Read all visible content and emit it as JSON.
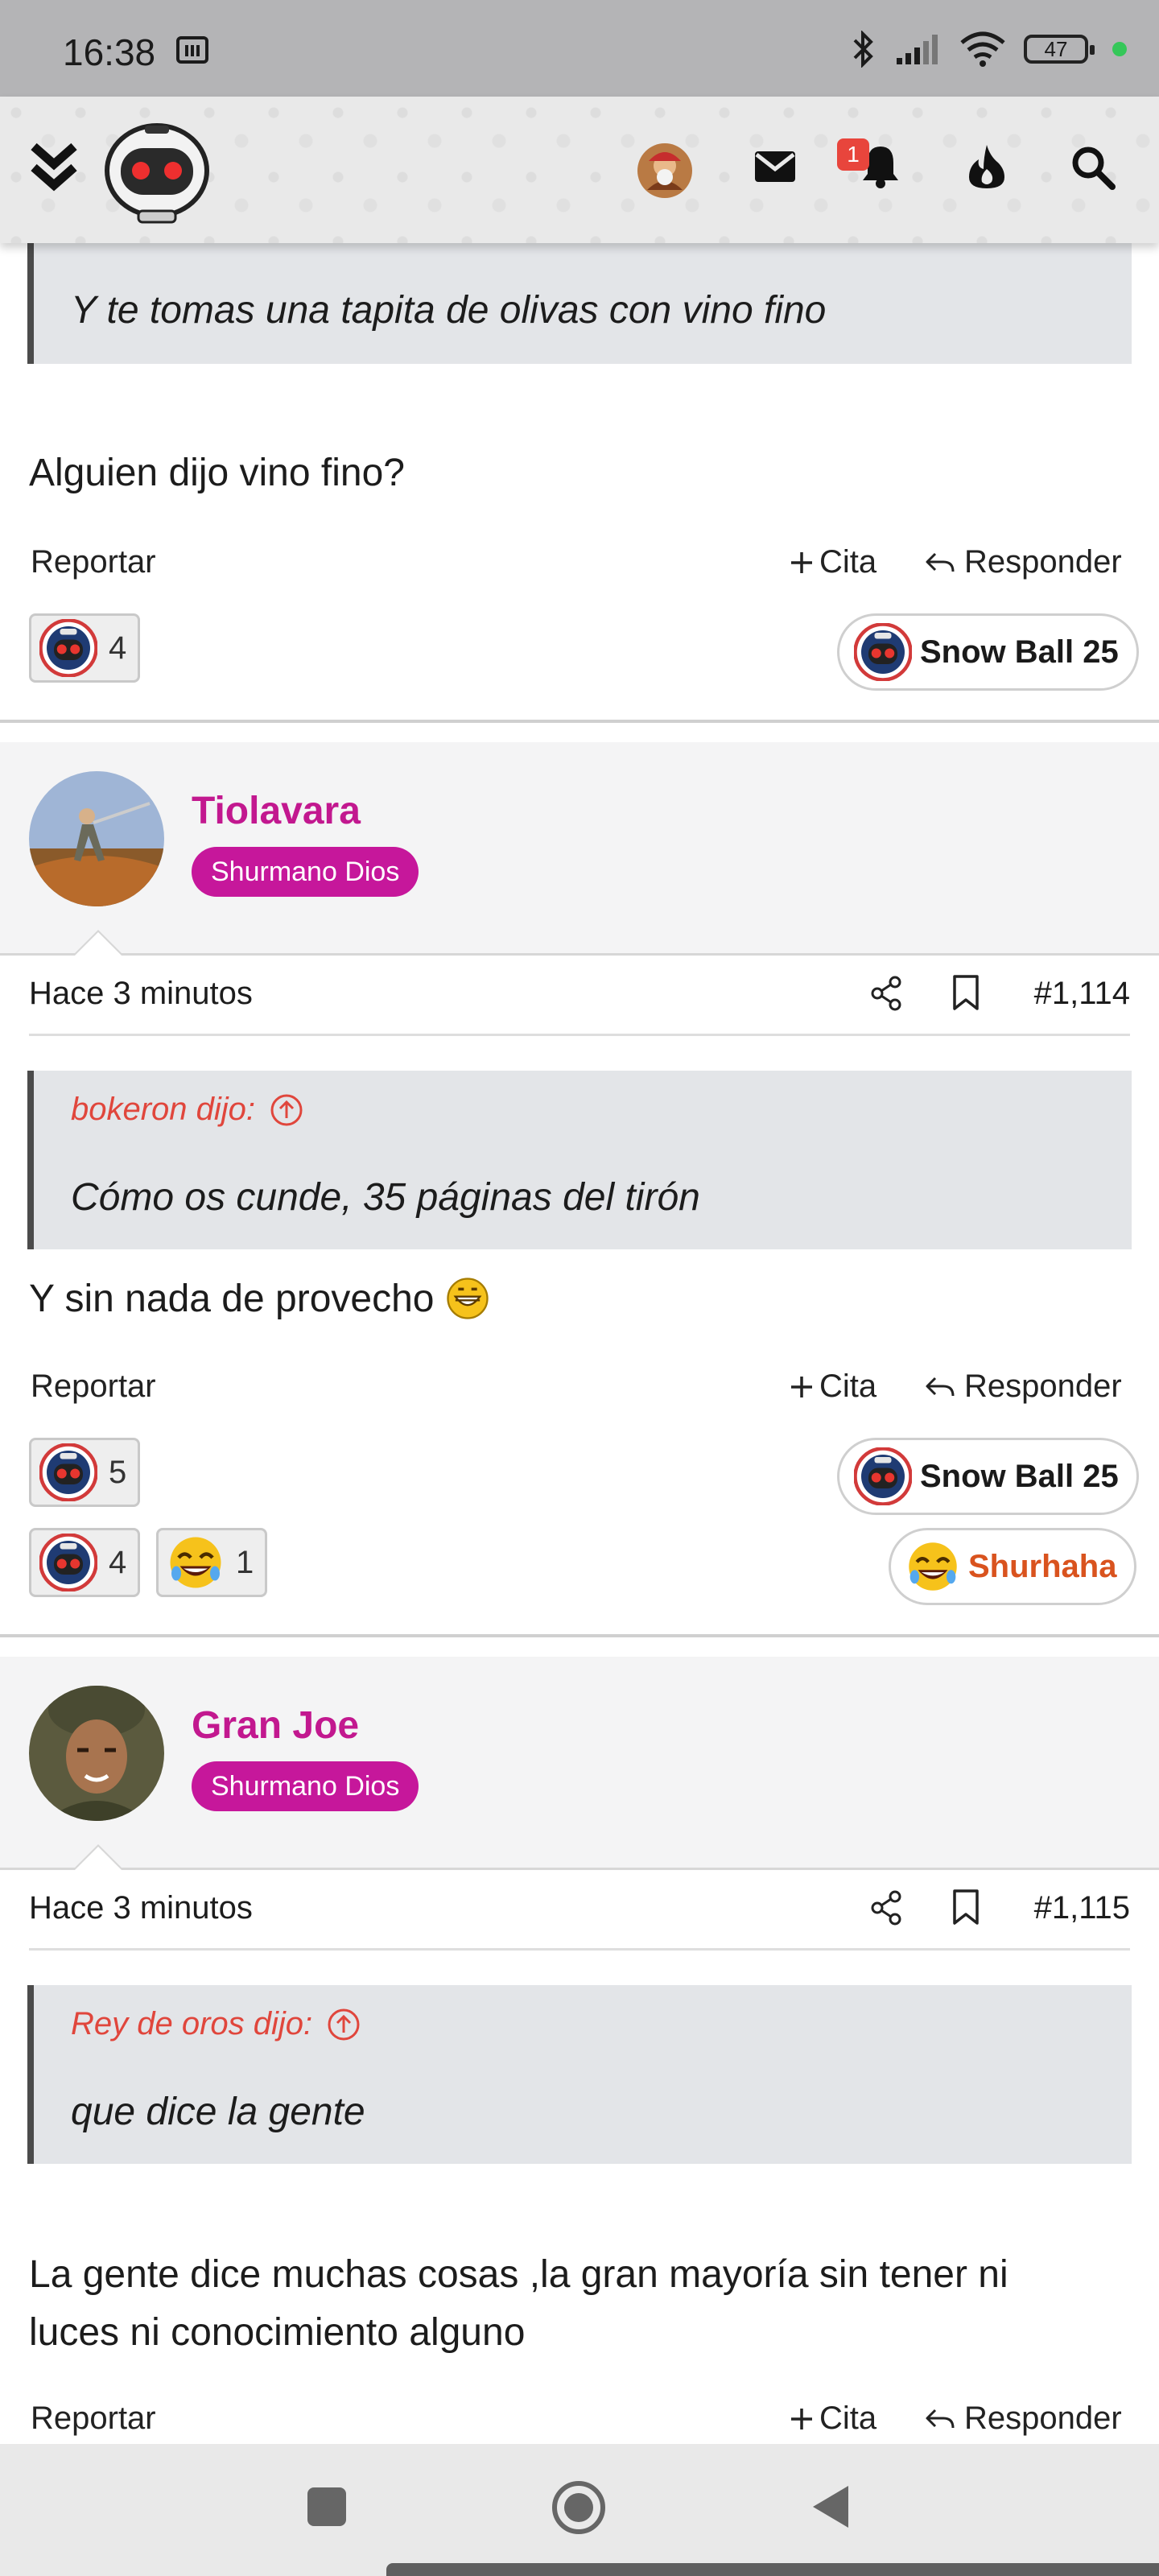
{
  "status_bar": {
    "time": "16:38",
    "battery": "47"
  },
  "app_header": {
    "notification_count": "1"
  },
  "posts": [
    {
      "quote_text": "Y te tomas una tapita de olivas con vino fino",
      "body": "Alguien dijo vino fino?",
      "actions": {
        "report": "Reportar",
        "quote": "Cita",
        "reply": "Responder"
      },
      "reactions": [
        {
          "count": "4"
        }
      ],
      "awards": [
        {
          "label": "Snow Ball 25"
        }
      ]
    },
    {
      "username": "Tiolavara",
      "rank": "Shurmano Dios",
      "time": "Hace 3 minutos",
      "post_number": "#1,114",
      "quote_author": "bokeron dijo:",
      "quote_text": "Cómo os cunde, 35 páginas del tirón",
      "body": "Y sin nada de provecho",
      "actions": {
        "report": "Reportar",
        "quote": "Cita",
        "reply": "Responder"
      },
      "reactions_row1": [
        {
          "count": "5"
        }
      ],
      "reactions_row2": [
        {
          "count": "4"
        },
        {
          "count": "1"
        }
      ],
      "awards": [
        {
          "label": "Snow Ball 25"
        },
        {
          "label": "Shurhaha",
          "color": "#d9531e"
        }
      ]
    },
    {
      "username": "Gran Joe",
      "rank": "Shurmano Dios",
      "time": "Hace 3 minutos",
      "post_number": "#1,115",
      "quote_author": "Rey de oros dijo:",
      "quote_text": "que dice la gente",
      "body": "La gente dice muchas cosas ,la gran mayoría sin tener ni luces ni conocimiento alguno",
      "actions": {
        "report": "Reportar",
        "quote": "Cita",
        "reply": "Responder"
      }
    }
  ],
  "colors": {
    "username": "#c2188f",
    "rank_badge": "#c6179b",
    "quote_author": "#e0463c",
    "quote_bg": "#e3e5e8",
    "status_bar": "#b4b4b6"
  }
}
